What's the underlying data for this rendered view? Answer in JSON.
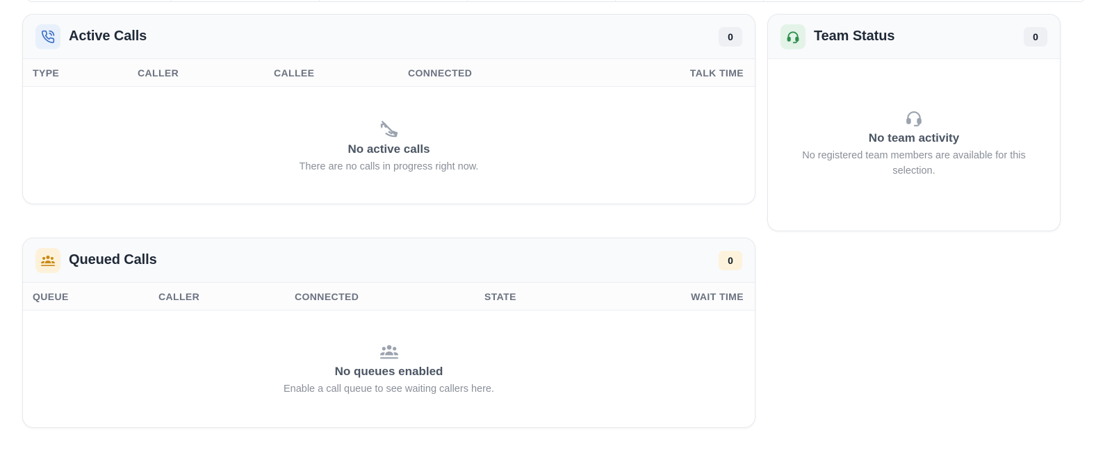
{
  "colors": {
    "active_icon": "#3b6fc6",
    "queue_icon": "#c98a17",
    "team_icon": "#2f8f4e",
    "empty_icon": "#9ba3ae"
  },
  "active_calls": {
    "title": "Active Calls",
    "count": "0",
    "icon": "phone-ringing-icon",
    "columns": [
      "TYPE",
      "CALLER",
      "CALLEE",
      "CONNECTED",
      "TALK TIME"
    ],
    "empty": {
      "icon": "phone-off-icon",
      "title": "No active calls",
      "description": "There are no calls in progress right now."
    }
  },
  "queued_calls": {
    "title": "Queued Calls",
    "count": "0",
    "icon": "users-group-icon",
    "columns": [
      "QUEUE",
      "CALLER",
      "CONNECTED",
      "STATE",
      "WAIT TIME"
    ],
    "empty": {
      "icon": "users-group-icon",
      "title": "No queues enabled",
      "description": "Enable a call queue to see waiting callers here."
    }
  },
  "team_status": {
    "title": "Team Status",
    "count": "0",
    "icon": "headset-icon",
    "empty": {
      "icon": "headset-icon",
      "title": "No team activity",
      "description": "No registered team members are available for this selection."
    }
  }
}
